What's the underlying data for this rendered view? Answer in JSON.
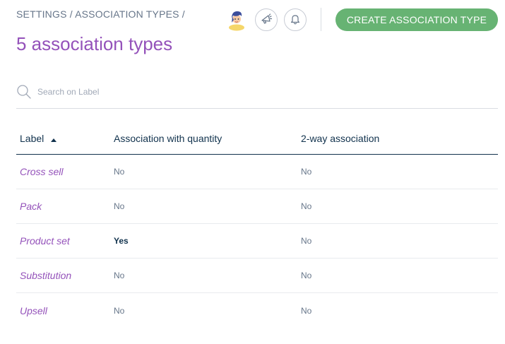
{
  "breadcrumb": {
    "settings": "Settings",
    "sep1": " / ",
    "association_types": "Association types",
    "sep2": " /"
  },
  "page_title": "5 association types",
  "header_actions": {
    "create_label": "Create association type",
    "create_color": "#67b373",
    "icons": [
      "user-avatar-icon",
      "announcement-icon",
      "bell-icon"
    ]
  },
  "search": {
    "placeholder": "Search on Label",
    "value": ""
  },
  "table": {
    "columns": {
      "label": "Label",
      "quantity": "Association with quantity",
      "two_way": "2-way association"
    },
    "sort_column": "Label",
    "sort_direction": "ascending",
    "rows": [
      {
        "label": "Cross sell",
        "quantity": "No",
        "two_way": "No"
      },
      {
        "label": "Pack",
        "quantity": "No",
        "two_way": "No"
      },
      {
        "label": "Product set",
        "quantity": "Yes",
        "two_way": "No"
      },
      {
        "label": "Substitution",
        "quantity": "No",
        "two_way": "No"
      },
      {
        "label": "Upsell",
        "quantity": "No",
        "two_way": "No"
      }
    ]
  },
  "colors": {
    "accent_purple": "#9452ba",
    "text_primary": "#11324d",
    "text_secondary": "#67768a"
  }
}
